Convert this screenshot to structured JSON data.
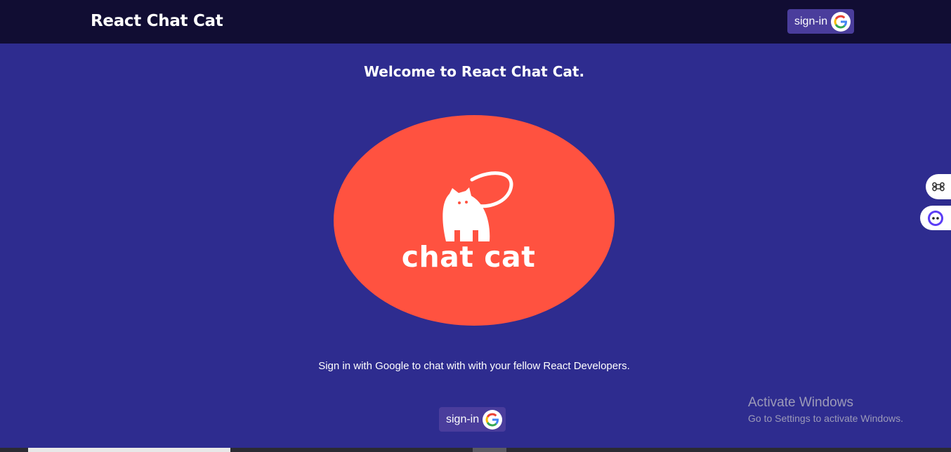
{
  "navbar": {
    "brand": "React Chat Cat",
    "signin_label": "sign-in"
  },
  "main": {
    "welcome": "Welcome to React Chat Cat.",
    "logo_text": "chat cat",
    "subtitle": "Sign in with Google to chat with with your fellow React Developers.",
    "signin_label": "sign-in"
  },
  "icons": {
    "google": "google-g-icon",
    "cat": "cat-icon",
    "shortcut": "command-key-icon",
    "assistant": "assistant-face-icon"
  },
  "watermark": {
    "title": "Activate Windows",
    "subtitle": "Go to Settings to activate Windows."
  },
  "colors": {
    "navbar_bg": "#110d33",
    "page_bg": "#2e2c8f",
    "button_bg": "#4a3d9c",
    "logo_bg": "#ff5240"
  }
}
